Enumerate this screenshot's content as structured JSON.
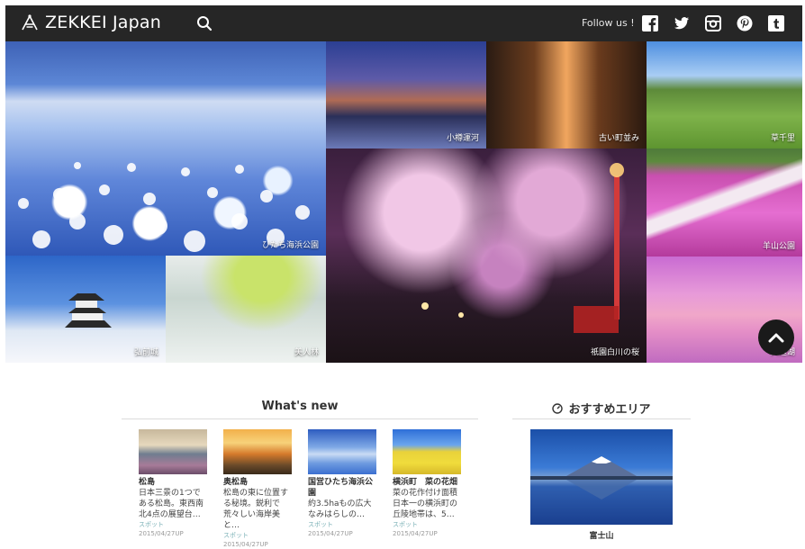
{
  "header": {
    "logo_text": "ZEKKEI Japan",
    "follow_label": "Follow us !",
    "social": [
      "facebook-icon",
      "twitter-icon",
      "instagram-icon",
      "pinterest-icon",
      "tumblr-icon"
    ]
  },
  "mosaic": [
    {
      "key": "nemo",
      "caption": "ひたち海浜公園"
    },
    {
      "key": "otaru",
      "caption": "小樽運河"
    },
    {
      "key": "street",
      "caption": "古い町並み"
    },
    {
      "key": "kusa",
      "caption": "草千里"
    },
    {
      "key": "gion",
      "caption": "祇園白川の桜"
    },
    {
      "key": "shiba",
      "caption": "羊山公園"
    },
    {
      "key": "hiro",
      "caption": "弘前城"
    },
    {
      "key": "bijin",
      "caption": "美人林"
    },
    {
      "key": "lake",
      "caption": "宍道湖"
    }
  ],
  "whats_new": {
    "title": "What's new",
    "items": [
      {
        "name": "松島",
        "desc": "日本三景の1つである松島。東西南北4点の展望台…",
        "category": "スポット",
        "date": "2015/04/27UP"
      },
      {
        "name": "奥松島",
        "desc": "松島の東に位置する秘境。鋭利で荒々しい海岸美と…",
        "category": "スポット",
        "date": "2015/04/27UP"
      },
      {
        "name": "国営ひたち海浜公園",
        "desc": "約3.5haもの広大なみはらしの…",
        "category": "スポット",
        "date": "2015/04/27UP"
      },
      {
        "name": "横浜町　菜の花畑",
        "desc": "菜の花作付け面積日本一の横浜町の丘陵地帯は、5…",
        "category": "スポット",
        "date": "2015/04/27UP"
      }
    ]
  },
  "recommend": {
    "title": "おすすめエリア",
    "caption": "富士山"
  }
}
